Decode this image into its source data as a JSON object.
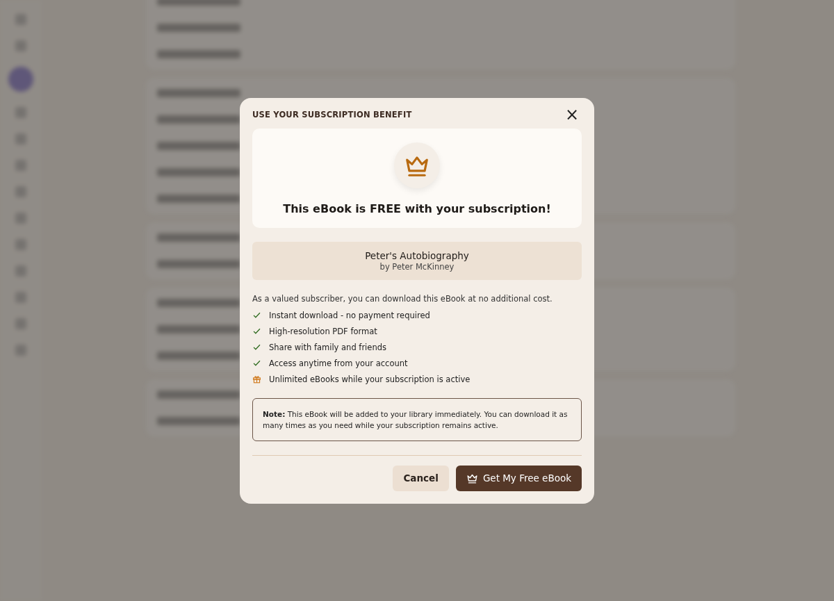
{
  "dialog": {
    "title": "USE YOUR SUBSCRIPTION BENEFIT",
    "close": "×",
    "headline": "This eBook is FREE with your subscription!",
    "book": {
      "title": "Peter's Autobiography",
      "author": "by Peter McKinney"
    },
    "intro": "As a valued subscriber, you can download this eBook at no additional cost.",
    "benefits": [
      {
        "kind": "check",
        "text": "Instant download - no payment required"
      },
      {
        "kind": "check",
        "text": "High-resolution PDF format"
      },
      {
        "kind": "check",
        "text": "Share with family and friends"
      },
      {
        "kind": "check",
        "text": "Access anytime from your account"
      },
      {
        "kind": "gift",
        "text": "Unlimited eBooks while your subscription is active"
      }
    ],
    "note": "**Note:** This eBook will be added to your library immediately. You can download it as many times as you need while your subscription remains active.",
    "buttons": [
      {
        "kind": "secondary",
        "label": "Cancel"
      },
      {
        "kind": "primary",
        "label": "Get My Free eBook"
      }
    ]
  }
}
